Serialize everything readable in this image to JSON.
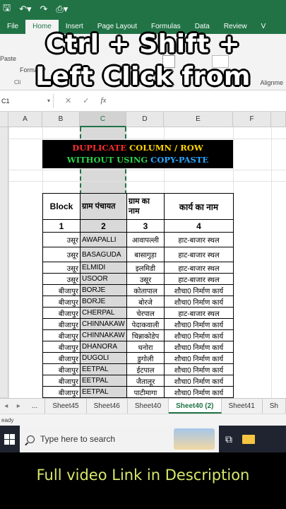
{
  "overlay": {
    "line1": "Ctrl +  Shift +",
    "line2": "Left Click from"
  },
  "titlebar": {
    "save_icon": "save-icon",
    "undo_icon": "undo-icon",
    "redo_icon": "redo-icon",
    "preview_icon": "print-preview-icon"
  },
  "ribbon": {
    "tabs": [
      "File",
      "Home",
      "Insert",
      "Page Layout",
      "Formulas",
      "Data",
      "Review",
      "V"
    ],
    "paste_label": "Paste",
    "format_painter_label": "Format P",
    "clipboard_label": "Cli",
    "alignment_label": "Alignme"
  },
  "formula_bar": {
    "name_box": "C1",
    "cancel": "✕",
    "enter": "✓",
    "fx": "fx"
  },
  "columns": [
    "A",
    "B",
    "C",
    "D",
    "E",
    "F"
  ],
  "banner": {
    "line1_red": "DUPLICATE ",
    "line1_yellow": "COLUMN / ROW",
    "line2_green": "WITHOUT USING ",
    "line2_blue": "COPY-PASTE"
  },
  "table": {
    "headers": [
      "Block",
      "ग्राम पंचायत",
      "ग्राम का नाम",
      "कार्य का नाम"
    ],
    "numbers": [
      "1",
      "2",
      "3",
      "4"
    ],
    "rows": [
      [
        "उसूर",
        "AWAPALLI",
        "आवापल्ली",
        "हाट-बाजार स्थल"
      ],
      [
        "उसूर",
        "BASAGUDA",
        "बासागुड़ा",
        "हाट-बाजार स्थल"
      ],
      [
        "उसूर",
        "ELMIDI",
        "इलमिडी",
        "हाट-बाजार स्थल"
      ],
      [
        "उसूर",
        "USOOR",
        "उसूर",
        "हाट-बाजार स्थल"
      ],
      [
        "बीजापुर",
        "BORJE",
        "कोतापाल",
        "शौचा0 निर्माण कार्य"
      ],
      [
        "बीजापुर",
        "BORJE",
        "बोरजे",
        "शौचा0 निर्माण कार्य"
      ],
      [
        "बीजापुर",
        "CHERPAL",
        "चेरपाल",
        "हाट-बाजार स्थल"
      ],
      [
        "बीजापुर",
        "CHINNAKAW",
        "पेदाकवाली",
        "शौचा0 निर्माण कार्य"
      ],
      [
        "बीजापुर",
        "CHINNAKAW",
        "चिन्नाकोडेप",
        "शौचा0 निर्माण कार्य"
      ],
      [
        "बीजापुर",
        "DHANORA",
        "धनोरा",
        "शौचा0 निर्माण कार्य"
      ],
      [
        "बीजापुर",
        "DUGOLI",
        "डुगोली",
        "शौचा0 निर्माण कार्य"
      ],
      [
        "बीजापुर",
        "EETPAL",
        "ईटपाल",
        "शौचा0 निर्माण कार्य"
      ],
      [
        "बीजापुर",
        "EETPAL",
        "जैतालूर",
        "शौचा0 निर्माण कार्य"
      ],
      [
        "बीजापुर",
        "EETPAL",
        "पाटीमागा",
        "शौचा0 निर्माण कार्य"
      ]
    ]
  },
  "sheet_tabs": {
    "ellipsis": "...",
    "tabs": [
      "Sheet45",
      "Sheet46",
      "Sheet40",
      "Sheet40 (2)",
      "Sheet41",
      "Sh"
    ],
    "active": "Sheet40 (2)"
  },
  "status": {
    "text": "eady"
  },
  "taskbar": {
    "search_placeholder": "Type here to search"
  },
  "bottom_caption": "Full video Link in Description",
  "colors": {
    "excel_green": "#217346",
    "caption_yellow": "#d7e86a"
  }
}
